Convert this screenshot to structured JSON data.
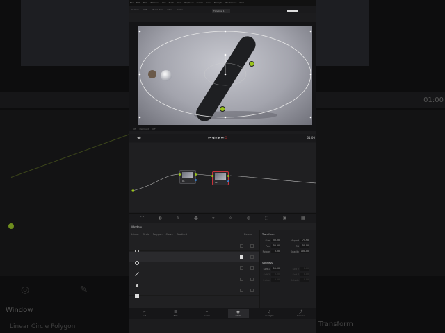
{
  "app": {
    "menu": [
      "File",
      "Edit",
      "Trim",
      "Timeline",
      "Clip",
      "Mark",
      "View",
      "Playback",
      "Fusion",
      "Color",
      "Fairlight",
      "Workspace",
      "Help"
    ],
    "timeline_name": "Timeline 1",
    "project": "DaVi",
    "toolbar_left": [
      "Gallery",
      "LUTs",
      "Media Pool",
      "Clips",
      "Nodes"
    ],
    "under_viewer": [
      "Off",
      "Highlight",
      "Off"
    ],
    "timecode": "01:00",
    "transport_buttons": [
      "⏮",
      "◀",
      "⏹",
      "▶",
      "⏭",
      "⟳"
    ]
  },
  "nodes": [
    {
      "label": "01"
    },
    {
      "label": "02"
    }
  ],
  "palette_icons": [
    "curves-icon",
    "qualifier-icon",
    "eyedropper-icon",
    "window-icon",
    "tracker-icon",
    "magic-mask-icon",
    "blur-icon",
    "key-icon",
    "sizing-icon",
    "3d-icon"
  ],
  "window_panel": {
    "title": "Window",
    "shape_tabs": [
      "Linear",
      "Circle",
      "Polygon",
      "Curve",
      "Gradient"
    ],
    "delete_label": "Delete",
    "shapes": [
      {
        "name": "square-window",
        "selected": false,
        "enabled": false
      },
      {
        "name": "circle-window",
        "selected": true,
        "enabled": true
      },
      {
        "name": "linear-window",
        "selected": false,
        "enabled": false
      },
      {
        "name": "polygon-window",
        "selected": false,
        "enabled": false
      },
      {
        "name": "gradient-window",
        "selected": false,
        "enabled": false
      }
    ],
    "transform": {
      "title": "Transform",
      "params": [
        {
          "label": "Size",
          "value": "50.00"
        },
        {
          "label": "Aspect",
          "value": "74.90"
        },
        {
          "label": "Pan",
          "value": "50.00"
        },
        {
          "label": "Tilt",
          "value": "50.00"
        },
        {
          "label": "Rotate",
          "value": "0.00"
        },
        {
          "label": "Opacity",
          "value": "100.00"
        }
      ]
    },
    "softness": {
      "title": "Softness",
      "params": [
        {
          "label": "Soft 1",
          "value": "15.00"
        },
        {
          "label": "Soft 2",
          "value": "0.00"
        },
        {
          "label": "Soft 3",
          "value": "0.00"
        },
        {
          "label": "Soft 4",
          "value": "0.00"
        },
        {
          "label": "Inside",
          "value": "0.00"
        },
        {
          "label": "Outside",
          "value": "0.00"
        }
      ]
    }
  },
  "pages": [
    {
      "label": "Cut",
      "icon": "cut-icon",
      "active": false
    },
    {
      "label": "Edit",
      "icon": "edit-icon",
      "active": false
    },
    {
      "label": "Fusion",
      "icon": "fusion-icon",
      "active": false
    },
    {
      "label": "Color",
      "icon": "color-icon",
      "active": true
    },
    {
      "label": "Fairlight",
      "icon": "fairlight-icon",
      "active": false
    },
    {
      "label": "Deliver",
      "icon": "deliver-icon",
      "active": false
    }
  ],
  "background": {
    "window_label": "Window",
    "tabs": "Linear    Circle    Polygon",
    "transform_label": "Transform",
    "timecode": "01:00"
  },
  "colors": {
    "accent_red": "#c8323a",
    "node_green": "#9ac31c",
    "wire": "#b8b8b8"
  }
}
